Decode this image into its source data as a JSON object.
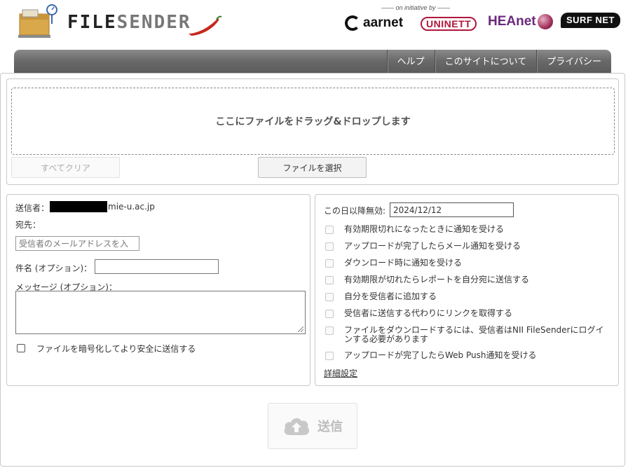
{
  "header": {
    "logo_text_a": "FILE",
    "logo_text_b": "SENDER",
    "initiative": "—— on initiative by ——",
    "partners": [
      "aarnet",
      "UNINETT",
      "HEAnet",
      "SURF NET"
    ]
  },
  "nav": {
    "items": [
      "ヘルプ",
      "このサイトについて",
      "プライバシー"
    ]
  },
  "upload": {
    "dropzone_label": "ここにファイルをドラッグ&ドロップします",
    "clear_all": "すべてクリア",
    "select_files": "ファイルを選択"
  },
  "form": {
    "from_label": "送信者：",
    "from_value": "mie-u.ac.jp",
    "to_label": "宛先：",
    "to_placeholder": "受信者のメールアドレスを入",
    "subject_label": "件名 (オプション)：",
    "subject_value": "",
    "message_label": "メッセージ (オプション)：",
    "message_value": "",
    "encrypt_label": "ファイルを暗号化してより安全に送信する"
  },
  "options": {
    "expiry_label": "この日以降無効:",
    "expiry_value": "2024/12/12",
    "items": [
      {
        "label": "有効期限切れになったときに通知を受ける",
        "checked": true,
        "disabled": true
      },
      {
        "label": "アップロードが完了したらメール通知を受ける",
        "checked": false,
        "disabled": true
      },
      {
        "label": "ダウンロード時に通知を受ける",
        "checked": true,
        "disabled": true
      },
      {
        "label": "有効期限が切れたらレポートを自分宛に送信する",
        "checked": true,
        "disabled": true
      },
      {
        "label": "自分を受信者に追加する",
        "checked": false,
        "disabled": true
      },
      {
        "label": "受信者に送信する代わりにリンクを取得する",
        "checked": false,
        "disabled": true
      },
      {
        "label": "ファイルをダウンロードするには、受信者はNII FileSenderにログインする必要があります",
        "checked": false,
        "disabled": true
      },
      {
        "label": "アップロードが完了したらWeb Push通知を受ける",
        "checked": true,
        "disabled": true
      }
    ],
    "advanced_link": "詳細設定"
  },
  "send": {
    "label": "送信"
  }
}
